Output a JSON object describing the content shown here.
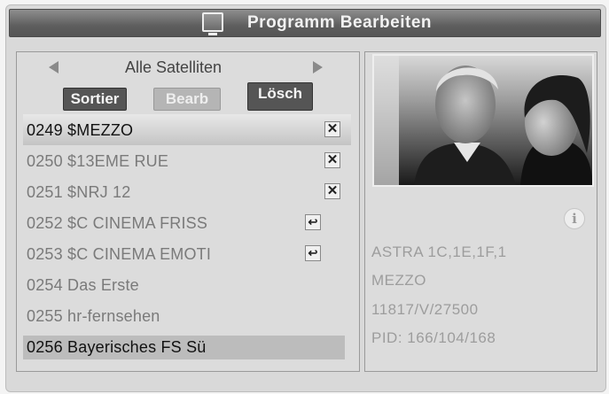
{
  "header": {
    "title": "Programm Bearbeiten",
    "icon": "tv-icon"
  },
  "satellite_selector": {
    "label": "Alle Satelliten",
    "prev_icon": "triangle-left-icon",
    "next_icon": "triangle-right-icon"
  },
  "buttons": {
    "sortier": "Sortier",
    "bearb": "Bearb",
    "losch": "Lösch"
  },
  "channels": [
    {
      "label": "0249 $MEZZO",
      "icon": "x",
      "selected": true
    },
    {
      "label": "0250 $13EME RUE",
      "icon": "x"
    },
    {
      "label": "0251 $NRJ 12",
      "icon": "x"
    },
    {
      "label": "0252 $C CINEMA FRISS",
      "icon": "move"
    },
    {
      "label": "0253 $C CINEMA EMOTI",
      "icon": "move"
    },
    {
      "label": "0254 Das Erste",
      "icon": ""
    },
    {
      "label": "0255 hr-fernsehen",
      "icon": ""
    },
    {
      "label": "0256 Bayerisches FS Sü",
      "icon": "",
      "highlighted": true
    }
  ],
  "details": {
    "info_icon": "i",
    "satellite": "ASTRA 1C,1E,1F,1",
    "channel": "MEZZO",
    "transponder": "11817/V/27500",
    "pid": "PID: 166/104/168"
  },
  "colors": {
    "title_bar": "#5e5e5e",
    "panel": "#dcdcdc",
    "highlight": "#bcbcbc"
  }
}
